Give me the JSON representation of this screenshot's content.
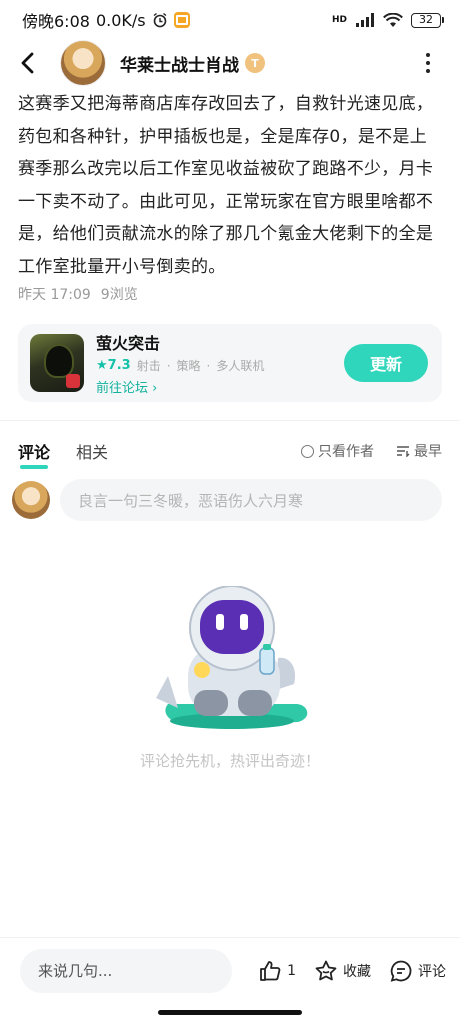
{
  "status_bar": {
    "carrier_time": "傍晚6:08",
    "speed": "0.0K/s",
    "network": "HD",
    "battery": "32"
  },
  "header": {
    "author_name": "华莱士战士肖战",
    "badge_text": "T"
  },
  "post": {
    "body": "这赛季又把海蒂商店库存改回去了，自救针光速见底，药包和各种针，护甲插板也是，全是库存0，是不是上赛季那么改完以后工作室见收益被砍了跑路不少，月卡一下卖不动了。由此可见，正常玩家在官方眼里啥都不是，给他们贡献流水的除了那几个氪金大佬剩下的全是工作室批量开小号倒卖的。",
    "time": "昨天 17:09",
    "views": "9浏览"
  },
  "game_card": {
    "name": "萤火突击",
    "rating": "★7.3",
    "tags": [
      "射击",
      "策略",
      "多人联机"
    ],
    "forum_link": "前往论坛 ›",
    "update_label": "更新"
  },
  "tabs": {
    "comments": "评论",
    "related": "相关",
    "author_only": "只看作者",
    "sort": "最早"
  },
  "comment_box": {
    "placeholder": "良言一句三冬暖，恶语伤人六月寒"
  },
  "empty_state": {
    "text": "评论抢先机，热评出奇迹！"
  },
  "bottom_bar": {
    "input_placeholder": "来说几句...",
    "like_count": "1",
    "favorite_label": "收藏",
    "comment_label": "评论"
  },
  "colors": {
    "accent": "#2fd6bb",
    "link": "#14b3a0"
  }
}
